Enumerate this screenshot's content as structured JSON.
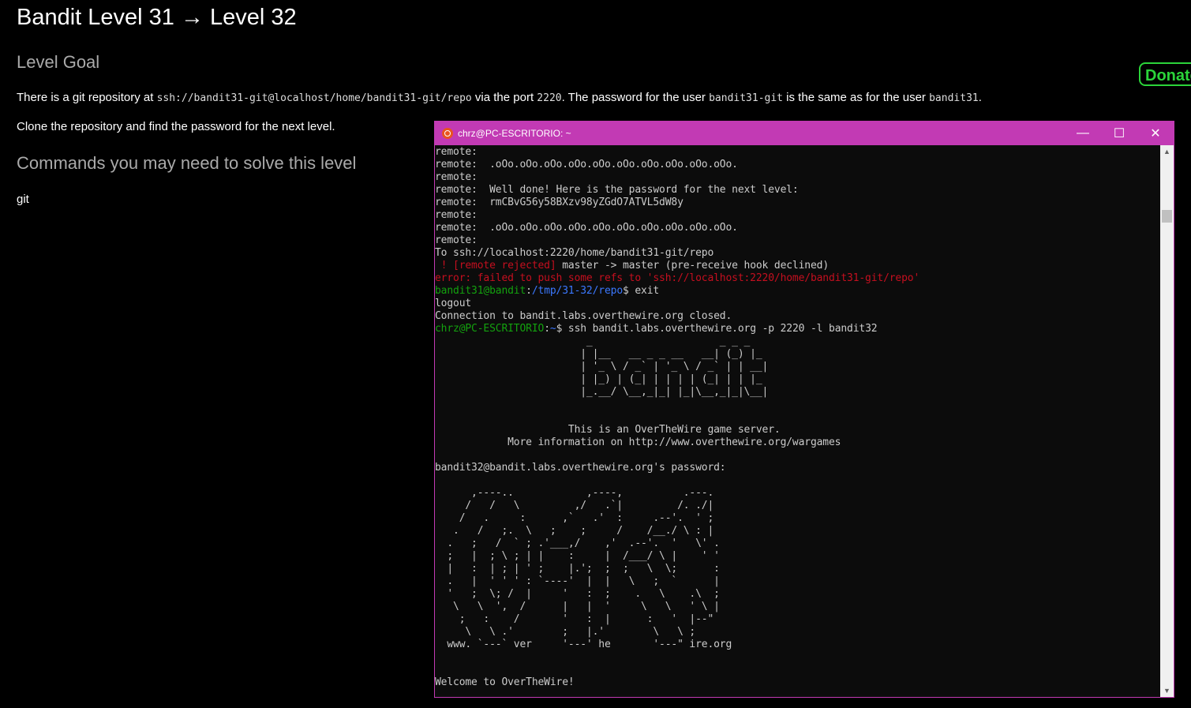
{
  "page": {
    "title": "Bandit Level 31 → Level 32",
    "goal_heading": "Level Goal",
    "goal_p1_a": "There is a git repository at ",
    "goal_p1_code1": "ssh://bandit31-git@localhost/home/bandit31-git/repo",
    "goal_p1_b": " via the port ",
    "goal_p1_code2": "2220",
    "goal_p1_c": ". The password for the user ",
    "goal_p1_code3": "bandit31-git",
    "goal_p1_d": " is the same as for the user ",
    "goal_p1_code4": "bandit31",
    "goal_p1_e": ".",
    "goal_p2": "Clone the repository and find the password for the next level.",
    "commands_heading": "Commands you may need to solve this level",
    "command_git": "git",
    "donate_label": "Donate"
  },
  "terminal": {
    "title": "chrz@PC-ESCRITORIO: ~",
    "minimize": "—",
    "maximize": "☐",
    "close": "✕",
    "scroll_position": 0.1,
    "lines": [
      {
        "segments": [
          {
            "t": "remote:"
          }
        ]
      },
      {
        "segments": [
          {
            "t": "remote:  .oOo.oOo.oOo.oOo.oOo.oOo.oOo.oOo.oOo.oOo."
          }
        ]
      },
      {
        "segments": [
          {
            "t": "remote:"
          }
        ]
      },
      {
        "segments": [
          {
            "t": "remote:  Well done! Here is the password for the next level:"
          }
        ]
      },
      {
        "segments": [
          {
            "t": "remote:  rmCBvG56y58BXzv98yZGdO7ATVL5dW8y"
          }
        ]
      },
      {
        "segments": [
          {
            "t": "remote:"
          }
        ]
      },
      {
        "segments": [
          {
            "t": "remote:  .oOo.oOo.oOo.oOo.oOo.oOo.oOo.oOo.oOo.oOo."
          }
        ]
      },
      {
        "segments": [
          {
            "t": "remote:"
          }
        ]
      },
      {
        "segments": [
          {
            "t": "To ssh://localhost:2220/home/bandit31-git/repo"
          }
        ]
      },
      {
        "segments": [
          {
            "t": " ! [remote rejected]",
            "c": "red"
          },
          {
            "t": " master -> master (pre-receive hook declined)"
          }
        ]
      },
      {
        "segments": [
          {
            "t": "error: failed to push some refs to 'ssh://localhost:2220/home/bandit31-git/repo'",
            "c": "red"
          }
        ]
      },
      {
        "segments": [
          {
            "t": "bandit31@bandit",
            "c": "grn"
          },
          {
            "t": ":"
          },
          {
            "t": "/tmp/31-32/repo",
            "c": "blu"
          },
          {
            "t": "$ exit"
          }
        ]
      },
      {
        "segments": [
          {
            "t": "logout"
          }
        ]
      },
      {
        "segments": [
          {
            "t": "Connection to bandit.labs.overthewire.org closed."
          }
        ]
      },
      {
        "segments": [
          {
            "t": "chrz@PC-ESCRITORIO",
            "c": "grn"
          },
          {
            "t": ":"
          },
          {
            "t": "~",
            "c": "blu"
          },
          {
            "t": "$ ssh bandit.labs.overthewire.org -p 2220 -l bandit32"
          }
        ]
      },
      {
        "segments": [
          {
            "t": "                         _                     _ _ _"
          }
        ]
      },
      {
        "segments": [
          {
            "t": "                        | |__   __ _ _ __   __| (_) |_"
          }
        ]
      },
      {
        "segments": [
          {
            "t": "                        | '_ \\ / _` | '_ \\ / _` | | __|"
          }
        ]
      },
      {
        "segments": [
          {
            "t": "                        | |_) | (_| | | | | (_| | | |_"
          }
        ]
      },
      {
        "segments": [
          {
            "t": "                        |_.__/ \\__,_|_| |_|\\__,_|_|\\__|"
          }
        ]
      },
      {
        "segments": [
          {
            "t": ""
          }
        ]
      },
      {
        "segments": [
          {
            "t": ""
          }
        ]
      },
      {
        "segments": [
          {
            "t": "                      This is an OverTheWire game server."
          }
        ]
      },
      {
        "segments": [
          {
            "t": "            More information on http://www.overthewire.org/wargames"
          }
        ]
      },
      {
        "segments": [
          {
            "t": ""
          }
        ]
      },
      {
        "segments": [
          {
            "t": "bandit32@bandit.labs.overthewire.org's password:"
          }
        ]
      },
      {
        "segments": [
          {
            "t": ""
          }
        ]
      },
      {
        "segments": [
          {
            "t": "      ,----..            ,----,          .---."
          }
        ]
      },
      {
        "segments": [
          {
            "t": "     /   /   \\         ,/   .`|         /. ./|"
          }
        ]
      },
      {
        "segments": [
          {
            "t": "    /   .     :      ,`   .'  :     .--'.  ' ;"
          }
        ]
      },
      {
        "segments": [
          {
            "t": "   .   /   ;.  \\   ;    ;     /    /__./ \\ : |"
          }
        ]
      },
      {
        "segments": [
          {
            "t": "  .   ;   /  ` ; .'___,/    ,'  .--'.  '   \\' ."
          }
        ]
      },
      {
        "segments": [
          {
            "t": "  ;   |  ; \\ ; | |    :     |  /___/ \\ |    ' '"
          }
        ]
      },
      {
        "segments": [
          {
            "t": "  |   :  | ; | ' ;    |.';  ;  ;   \\  \\;      :"
          }
        ]
      },
      {
        "segments": [
          {
            "t": "  .   |  ' ' ' : `----'  |  |   \\   ;  `      |"
          }
        ]
      },
      {
        "segments": [
          {
            "t": "  '   ;  \\; /  |     '   :  ;    .   \\    .\\  ;"
          }
        ]
      },
      {
        "segments": [
          {
            "t": "   \\   \\  ',  /      |   |  '     \\   \\   ' \\ |"
          }
        ]
      },
      {
        "segments": [
          {
            "t": "    ;   :    /       '   :  |      :   '  |--\""
          }
        ]
      },
      {
        "segments": [
          {
            "t": "     \\   \\ .'        ;   |.'        \\   \\ ;"
          }
        ]
      },
      {
        "segments": [
          {
            "t": "  www. `---` ver     '---' he       '---\" ire.org"
          }
        ]
      },
      {
        "segments": [
          {
            "t": ""
          }
        ]
      },
      {
        "segments": [
          {
            "t": ""
          }
        ]
      },
      {
        "segments": [
          {
            "t": "Welcome to OverTheWire!"
          }
        ]
      }
    ]
  }
}
